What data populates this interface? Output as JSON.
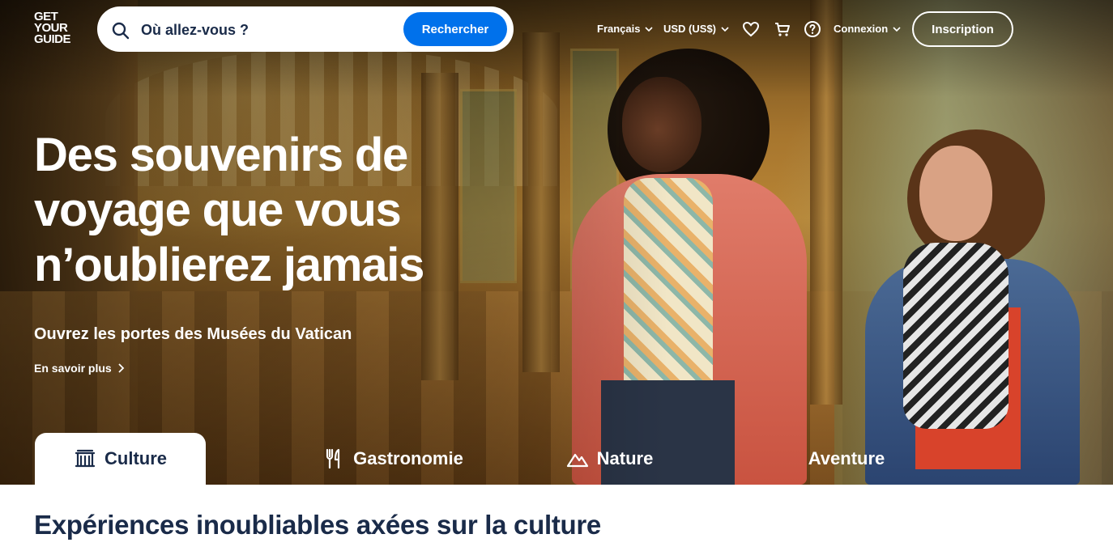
{
  "brand": {
    "logo_lines": [
      "GET",
      "YOUR",
      "GUIDE"
    ],
    "accent_color": "#0071eb",
    "text_dark": "#1a2b49"
  },
  "search": {
    "placeholder": "Où allez-vous ?",
    "icon": "search-icon",
    "button_label": "Rechercher"
  },
  "nav": {
    "language": "Français",
    "currency": "USD (US$)",
    "wishlist_icon": "heart-icon",
    "cart_icon": "cart-icon",
    "help_icon": "help-icon",
    "login": "Connexion",
    "signup": "Inscription"
  },
  "hero": {
    "headline_lines": [
      "Des souvenirs de",
      "voyage que vous",
      "n’oublierez jamais"
    ],
    "subheadline": "Ouvrez les portes des Musées du Vatican",
    "learn_more": "En savoir plus"
  },
  "tabs": [
    {
      "label": "Culture",
      "icon": "museum-icon",
      "active": true
    },
    {
      "label": "Gastronomie",
      "icon": "fork-knife-icon",
      "active": false
    },
    {
      "label": "Nature",
      "icon": "mountain-icon",
      "active": false
    },
    {
      "label": "Aventure",
      "icon": "",
      "active": false
    }
  ],
  "section": {
    "title": "Expériences inoubliables axées sur la culture"
  }
}
